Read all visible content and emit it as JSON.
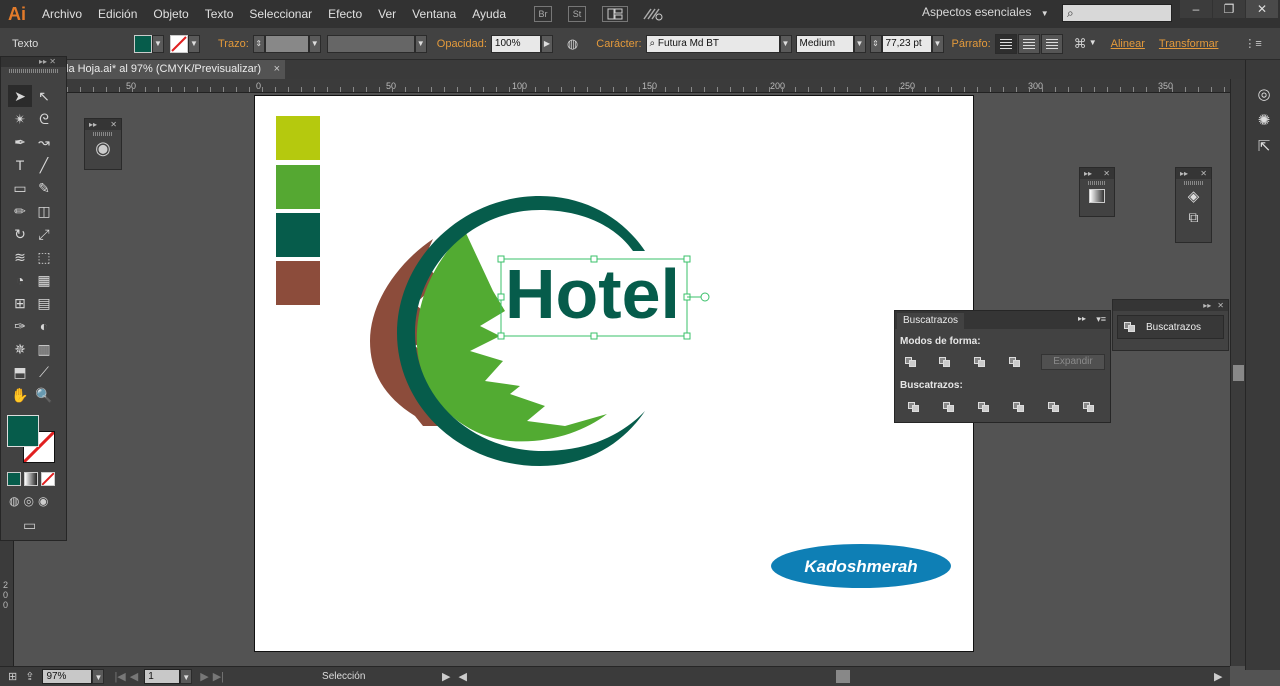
{
  "app": {
    "logo": "Ai"
  },
  "menu": [
    "Archivo",
    "Edición",
    "Objeto",
    "Texto",
    "Seleccionar",
    "Efecto",
    "Ver",
    "Ventana",
    "Ayuda"
  ],
  "menu_icons": {
    "bridge": "Br",
    "stock": "St"
  },
  "workspace": "Aspectos esenciales",
  "window_controls": {
    "minimize": "–",
    "maximize": "❐",
    "close": "✕"
  },
  "control": {
    "object_type": "Texto",
    "stroke_label": "Trazo:",
    "opacity_label": "Opacidad:",
    "opacity_value": "100%",
    "character_label": "Carácter:",
    "font_family": "Futura Md BT",
    "font_style": "Medium",
    "font_size": "77,23 pt",
    "paragraph_label": "Párrafo:",
    "align_link": "Alinear",
    "transform_link": "Transformar"
  },
  "document": {
    "tab_title": "la Hoja.ai* al 97% (CMYK/Previsualizar)",
    "close": "×"
  },
  "ruler": {
    "labels": [
      "50",
      "0",
      "50",
      "100",
      "150",
      "200",
      "250",
      "300",
      "350"
    ],
    "vertical_labels": [
      "2",
      "0",
      "0"
    ]
  },
  "artwork": {
    "swatches": [
      "#b5c90e",
      "#55a832",
      "#065c4b",
      "#8c4c3b"
    ],
    "logo_text": "Hotel",
    "logo_color": "#065c4b",
    "ring_color": "#065c4b",
    "leaf_color": "#52ab32",
    "back_leaf_color": "#8c4c3b",
    "watermark": "Kadoshmerah",
    "watermark_bg": "#0e7fb5",
    "selection_color": "#3ac06a"
  },
  "pathfinder": {
    "tab": "Buscatrazos",
    "shape_modes_label": "Modos de forma:",
    "expand": "Expandir",
    "pathfinders_label": "Buscatrazos:"
  },
  "collapsed_panel": {
    "label": "Buscatrazos"
  },
  "status": {
    "zoom": "97%",
    "artboard": "1",
    "tool": "Selección"
  },
  "icons": {
    "ui": [
      "search-icon",
      "close-icon",
      "arrange-documents-icon",
      "gpu-performance-icon",
      "chevron-down-icon",
      "globe-icon"
    ],
    "tools": [
      "selection-tool-icon",
      "direct-selection-tool-icon",
      "magic-wand-tool-icon",
      "lasso-tool-icon",
      "pen-tool-icon",
      "curvature-tool-icon",
      "type-tool-icon",
      "line-tool-icon",
      "rectangle-tool-icon",
      "paintbrush-tool-icon",
      "pencil-tool-icon",
      "eraser-tool-icon",
      "rotate-tool-icon",
      "scale-tool-icon",
      "width-tool-icon",
      "free-transform-tool-icon",
      "shape-builder-tool-icon",
      "perspective-grid-tool-icon",
      "mesh-tool-icon",
      "gradient-tool-icon",
      "eyedropper-tool-icon",
      "blend-tool-icon",
      "symbol-sprayer-tool-icon",
      "column-graph-tool-icon",
      "artboard-tool-icon",
      "slice-tool-icon",
      "hand-tool-icon",
      "zoom-tool-icon"
    ],
    "right_strip": [
      "creative-cloud-icon",
      "color-guide-icon",
      "export-icon"
    ]
  }
}
